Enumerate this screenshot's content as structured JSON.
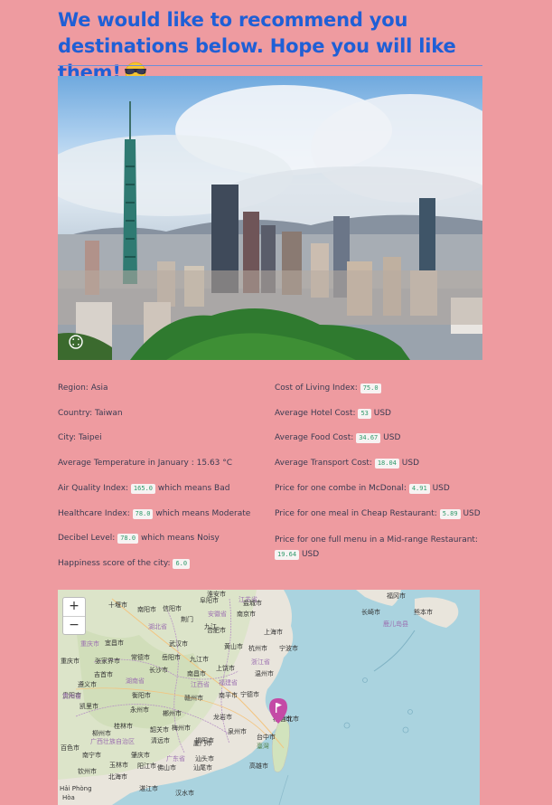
{
  "header": {
    "title": "We would like to recommend you destinations below. Hope you will like them!",
    "emoji": "smiling-face-with-sunglasses"
  },
  "photo": {
    "icon": "fullscreen-icon"
  },
  "left_column": [
    {
      "label": "Region: Asia"
    },
    {
      "label": "Country: Taiwan"
    },
    {
      "label": "City: Taipei"
    },
    {
      "label": "Average Temperature in January : 15.63 °C"
    },
    {
      "label": "Air Quality Index:",
      "value": "165.0",
      "suffix": "which means Bad"
    },
    {
      "label": "Healthcare Index:",
      "value": "78.0",
      "suffix": "which means Moderate"
    },
    {
      "label": "Decibel Level:",
      "value": "78.0",
      "suffix": "which means Noisy"
    },
    {
      "label": "Happiness score of the city:",
      "value": "6.0"
    }
  ],
  "right_column": [
    {
      "label": "Cost of Living Index:",
      "value": "75.0"
    },
    {
      "label": "Average Hotel Cost:",
      "value": "53",
      "suffix": "USD"
    },
    {
      "label": "Average Food Cost:",
      "value": "34.67",
      "suffix": "USD"
    },
    {
      "label": "Average Transport Cost:",
      "value": "18.04",
      "suffix": "USD"
    },
    {
      "label": "Price for one combe in McDonal:",
      "value": "4.91",
      "suffix": "USD"
    },
    {
      "label": "Price for one meal in Cheap Restaurant:",
      "value": "5.89",
      "suffix": "USD"
    },
    {
      "label": "Price for one full menu in a Mid-range Restaurant:",
      "value": "19.64",
      "suffix": "USD"
    }
  ],
  "map": {
    "zoom_in": "+",
    "zoom_out": "−",
    "labels": [
      {
        "text": "十堰市",
        "cls": ""
      },
      {
        "text": "南阳市",
        "cls": ""
      },
      {
        "text": "信阳市",
        "cls": ""
      },
      {
        "text": "阜阳市",
        "cls": ""
      },
      {
        "text": "江苏省",
        "cls": "purple"
      },
      {
        "text": "淮安市",
        "cls": ""
      },
      {
        "text": "盐城市",
        "cls": ""
      },
      {
        "text": "福冈市",
        "cls": ""
      },
      {
        "text": "长崎市",
        "cls": ""
      },
      {
        "text": "熊本市",
        "cls": ""
      },
      {
        "text": "鹿儿岛县",
        "cls": "purple"
      },
      {
        "text": "安徽省",
        "cls": "purple"
      },
      {
        "text": "南京市",
        "cls": ""
      },
      {
        "text": "合肥市",
        "cls": ""
      },
      {
        "text": "湖北省",
        "cls": "purple"
      },
      {
        "text": "武汉市",
        "cls": ""
      },
      {
        "text": "上海市",
        "cls": ""
      },
      {
        "text": "杭州市",
        "cls": ""
      },
      {
        "text": "宁波市",
        "cls": ""
      },
      {
        "text": "重庆市",
        "cls": "purple"
      },
      {
        "text": "宜昌市",
        "cls": ""
      },
      {
        "text": "常德市",
        "cls": ""
      },
      {
        "text": "岳阳市",
        "cls": ""
      },
      {
        "text": "九江市",
        "cls": ""
      },
      {
        "text": "黄山市",
        "cls": ""
      },
      {
        "text": "浙江省",
        "cls": "purple"
      },
      {
        "text": "重庆市",
        "cls": ""
      },
      {
        "text": "张家界市",
        "cls": ""
      },
      {
        "text": "长沙市",
        "cls": ""
      },
      {
        "text": "湖南省",
        "cls": "purple"
      },
      {
        "text": "南昌市",
        "cls": ""
      },
      {
        "text": "上饶市",
        "cls": ""
      },
      {
        "text": "温州市",
        "cls": ""
      },
      {
        "text": "江西省",
        "cls": "purple"
      },
      {
        "text": "福建省",
        "cls": "purple"
      },
      {
        "text": "吉首市",
        "cls": ""
      },
      {
        "text": "遵义市",
        "cls": ""
      },
      {
        "text": "贵阳市",
        "cls": ""
      },
      {
        "text": "贵州省",
        "cls": "purple"
      },
      {
        "text": "衡阳市",
        "cls": ""
      },
      {
        "text": "赣州市",
        "cls": ""
      },
      {
        "text": "南平市",
        "cls": ""
      },
      {
        "text": "宁德市",
        "cls": ""
      },
      {
        "text": "福州市",
        "cls": ""
      },
      {
        "text": "凯里市",
        "cls": ""
      },
      {
        "text": "永州市",
        "cls": ""
      },
      {
        "text": "郴州市",
        "cls": ""
      },
      {
        "text": "龙岩市",
        "cls": ""
      },
      {
        "text": "泉州市",
        "cls": ""
      },
      {
        "text": "广西壮族自治区",
        "cls": "purple"
      },
      {
        "text": "桂林市",
        "cls": ""
      },
      {
        "text": "韶关市",
        "cls": ""
      },
      {
        "text": "梅州市",
        "cls": ""
      },
      {
        "text": "厦门市",
        "cls": ""
      },
      {
        "text": "台中市",
        "cls": ""
      },
      {
        "text": "百色市",
        "cls": ""
      },
      {
        "text": "柳州市",
        "cls": ""
      },
      {
        "text": "清远市",
        "cls": ""
      },
      {
        "text": "揭阳市",
        "cls": ""
      },
      {
        "text": "臺灣",
        "cls": "green"
      },
      {
        "text": "南宁市",
        "cls": ""
      },
      {
        "text": "广东省",
        "cls": "purple"
      },
      {
        "text": "汕头市",
        "cls": ""
      },
      {
        "text": "肇庆市",
        "cls": ""
      },
      {
        "text": "佛山市",
        "cls": ""
      },
      {
        "text": "汕尾市",
        "cls": ""
      },
      {
        "text": "高雄市",
        "cls": ""
      },
      {
        "text": "钦州市",
        "cls": ""
      },
      {
        "text": "玉林市",
        "cls": ""
      },
      {
        "text": "阳江市",
        "cls": ""
      },
      {
        "text": "北海市",
        "cls": ""
      },
      {
        "text": "湛江市",
        "cls": ""
      },
      {
        "text": "Hòa",
        "cls": ""
      },
      {
        "text": "Hải Phòng",
        "cls": ""
      },
      {
        "text": "汉水市",
        "cls": ""
      },
      {
        "text": "九江",
        "cls": ""
      },
      {
        "text": "荆门",
        "cls": ""
      },
      {
        "text": "台北市",
        "cls": ""
      }
    ],
    "marker_icon": "map-pin-icon"
  }
}
